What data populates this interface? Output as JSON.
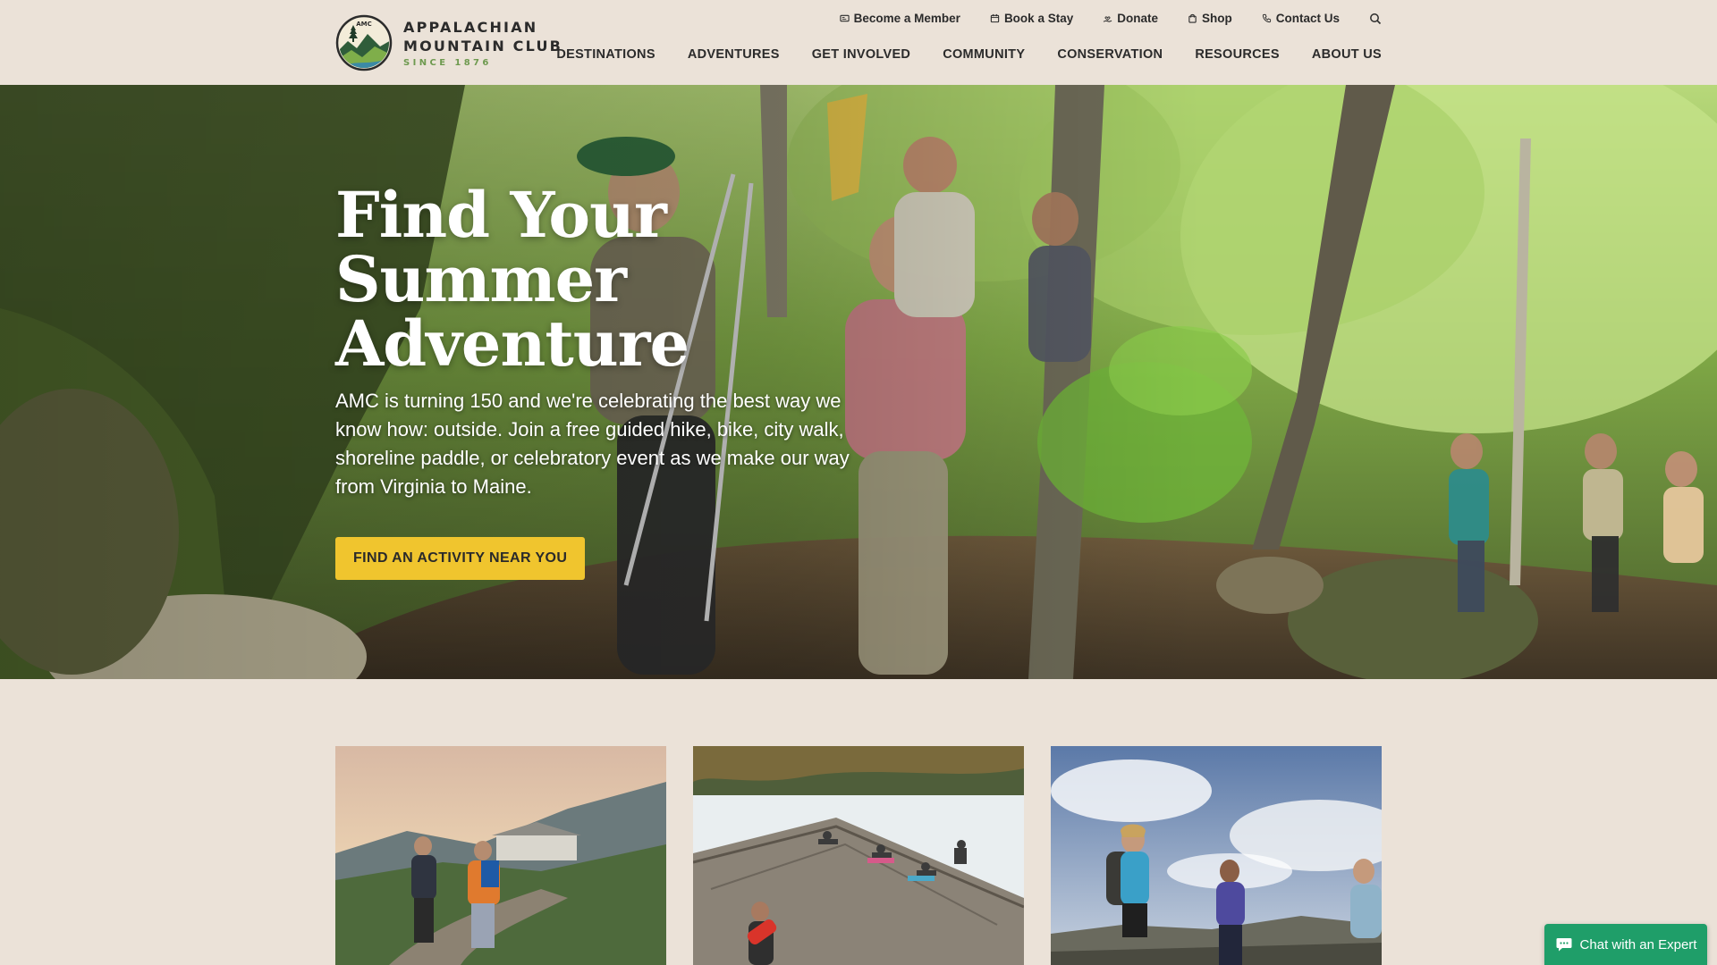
{
  "brand": {
    "line1": "APPALACHIAN",
    "line2": "MOUNTAIN CLUB",
    "since": "SINCE 1876",
    "seal_text": "AMC"
  },
  "utility_nav": [
    {
      "label": "Become a Member",
      "icon": "membership-card-icon"
    },
    {
      "label": "Book a Stay",
      "icon": "calendar-icon"
    },
    {
      "label": "Donate",
      "icon": "hand-heart-icon"
    },
    {
      "label": "Shop",
      "icon": "shopping-bag-icon"
    },
    {
      "label": "Contact Us",
      "icon": "phone-icon"
    }
  ],
  "search": {
    "icon": "search-icon"
  },
  "main_nav": [
    "DESTINATIONS",
    "ADVENTURES",
    "GET INVOLVED",
    "COMMUNITY",
    "CONSERVATION",
    "RESOURCES",
    "ABOUT US"
  ],
  "hero": {
    "title": "Find Your\nSummer\nAdventure",
    "body": "AMC is turning 150 and we're celebrating the best way we know how: outside. Join a free guided hike, bike, city walk, shoreline paddle, or celebratory event as we make our way from Virginia to Maine.",
    "cta": "FIND AN ACTIVITY NEAR YOU"
  },
  "cards": [
    {
      "image": "hikers-on-mountain-trail-photo"
    },
    {
      "image": "yoga-on-lake-dock-photo"
    },
    {
      "image": "hikers-on-summit-photo"
    }
  ],
  "chat": {
    "label": "Chat with an Expert",
    "icon": "chat-bubble-icon"
  },
  "colors": {
    "page_bg": "#ebe2d8",
    "cta_yellow": "#f0c52e",
    "chat_green": "#1f9e69",
    "brand_green": "#6e9a4f"
  }
}
